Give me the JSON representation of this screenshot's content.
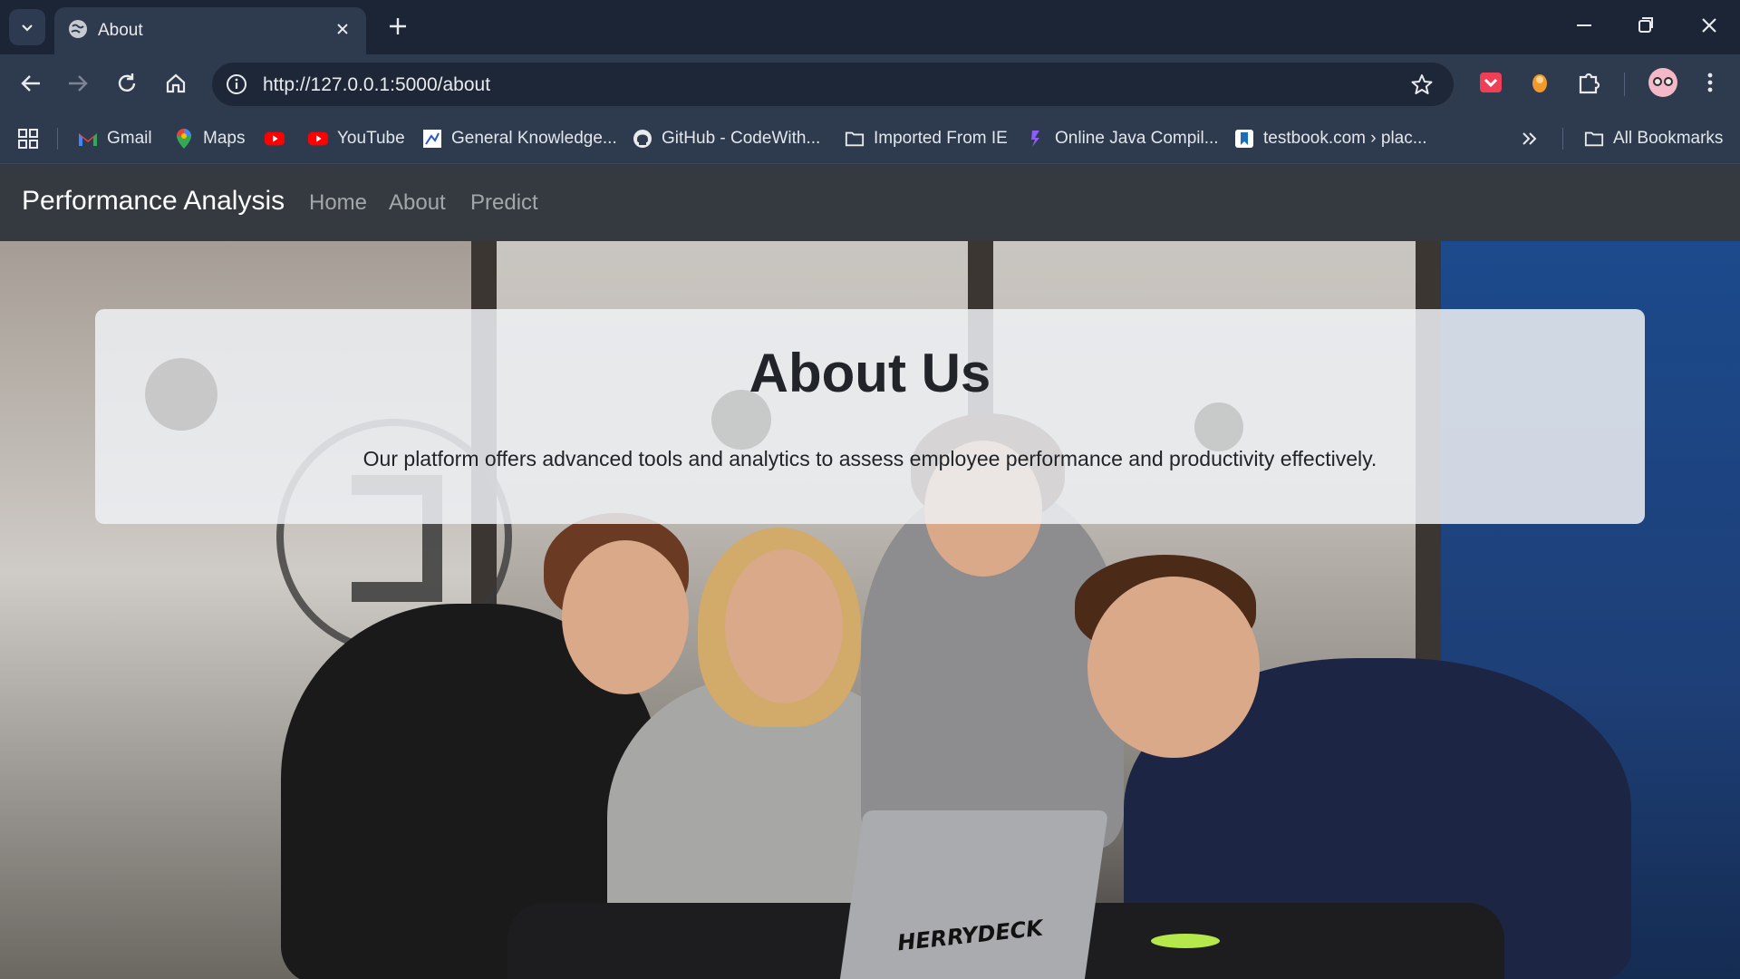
{
  "browser": {
    "tab": {
      "title": "About"
    },
    "address_bar": {
      "url": "http://127.0.0.1:5000/about"
    },
    "bookmarks": [
      {
        "label": "Gmail",
        "icon": "gmail-icon"
      },
      {
        "label": "Maps",
        "icon": "maps-icon"
      },
      {
        "label": "",
        "icon": "youtube-icon"
      },
      {
        "label": "YouTube",
        "icon": "youtube-icon"
      },
      {
        "label": "General Knowledge...",
        "icon": "page-icon"
      },
      {
        "label": "GitHub - CodeWith...",
        "icon": "github-icon"
      },
      {
        "label": "Imported From IE",
        "icon": "folder-icon"
      },
      {
        "label": "Online Java Compil...",
        "icon": "page-icon"
      },
      {
        "label": "testbook.com › plac...",
        "icon": "page-icon"
      }
    ],
    "all_bookmarks_label": "All Bookmarks",
    "colors": {
      "tabstrip": "#1b2536",
      "toolbar": "#2e3a4d",
      "omnibox": "#1d2738"
    }
  },
  "page": {
    "navbar": {
      "brand": "Performance Analysis",
      "links": [
        "Home",
        "About",
        "Predict"
      ]
    },
    "about": {
      "title": "About Us",
      "description": "Our platform offers advanced tools and analytics to assess employee performance and productivity effectively."
    },
    "laptop_sticker": "HERRYDECK",
    "colors": {
      "navbar": "#343a40",
      "card": "#eef0f3",
      "text": "#212529"
    }
  }
}
